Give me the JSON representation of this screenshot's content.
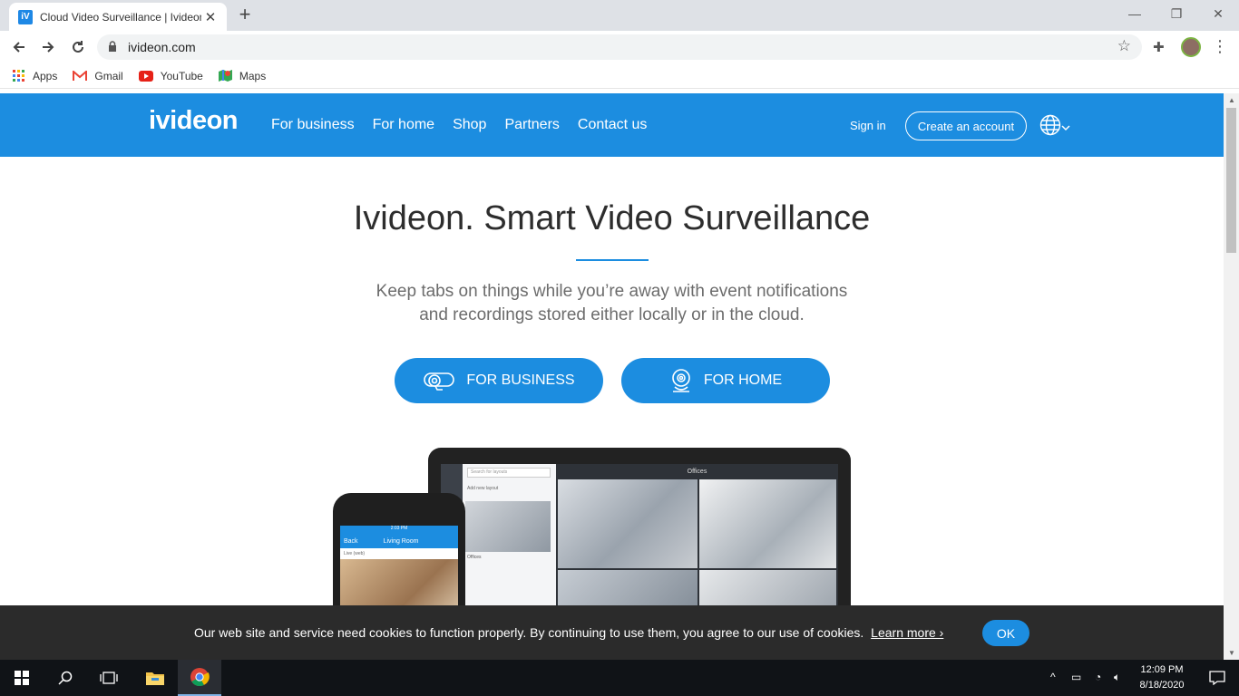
{
  "browser": {
    "tab_title": "Cloud Video Surveillance | Ivideon",
    "tab_favicon": "iV",
    "url": "ivideon.com",
    "window_controls": {
      "minimize": "—",
      "restore": "❐",
      "close": "✕"
    },
    "bookmarks": [
      {
        "label": "Apps",
        "icon": "apps-grid-icon"
      },
      {
        "label": "Gmail",
        "icon": "gmail-icon"
      },
      {
        "label": "YouTube",
        "icon": "youtube-icon"
      },
      {
        "label": "Maps",
        "icon": "maps-icon"
      }
    ]
  },
  "site": {
    "logo": "ivideon",
    "nav": [
      "For business",
      "For home",
      "Shop",
      "Partners",
      "Contact us"
    ],
    "sign_in": "Sign in",
    "create_account": "Create an account",
    "hero_title": "Ivideon. Smart Video Surveillance",
    "hero_sub_line1": "Keep tabs on things while you’re away with event notifications",
    "hero_sub_line2": "and recordings stored either locally or in the cloud.",
    "cta_business": "FOR BUSINESS",
    "cta_home": "FOR HOME",
    "accent_color": "#1c8de0"
  },
  "mockup": {
    "laptop_layout_title": "Offices",
    "laptop_search_placeholder": "Search for layouts",
    "laptop_add_layout": "Add new layout",
    "laptop_thumb_label": "Offices",
    "phone_status_time": "2:03 PM",
    "phone_back": "Back",
    "phone_title": "Living Room",
    "phone_live": "Live (web)"
  },
  "cookie_banner": {
    "text": "Our web site and service need cookies to function properly. By continuing to use them, you agree to our use of cookies.",
    "learn_more": "Learn more ›",
    "ok": "OK"
  },
  "taskbar": {
    "time": "12:09 PM",
    "date": "8/18/2020"
  }
}
